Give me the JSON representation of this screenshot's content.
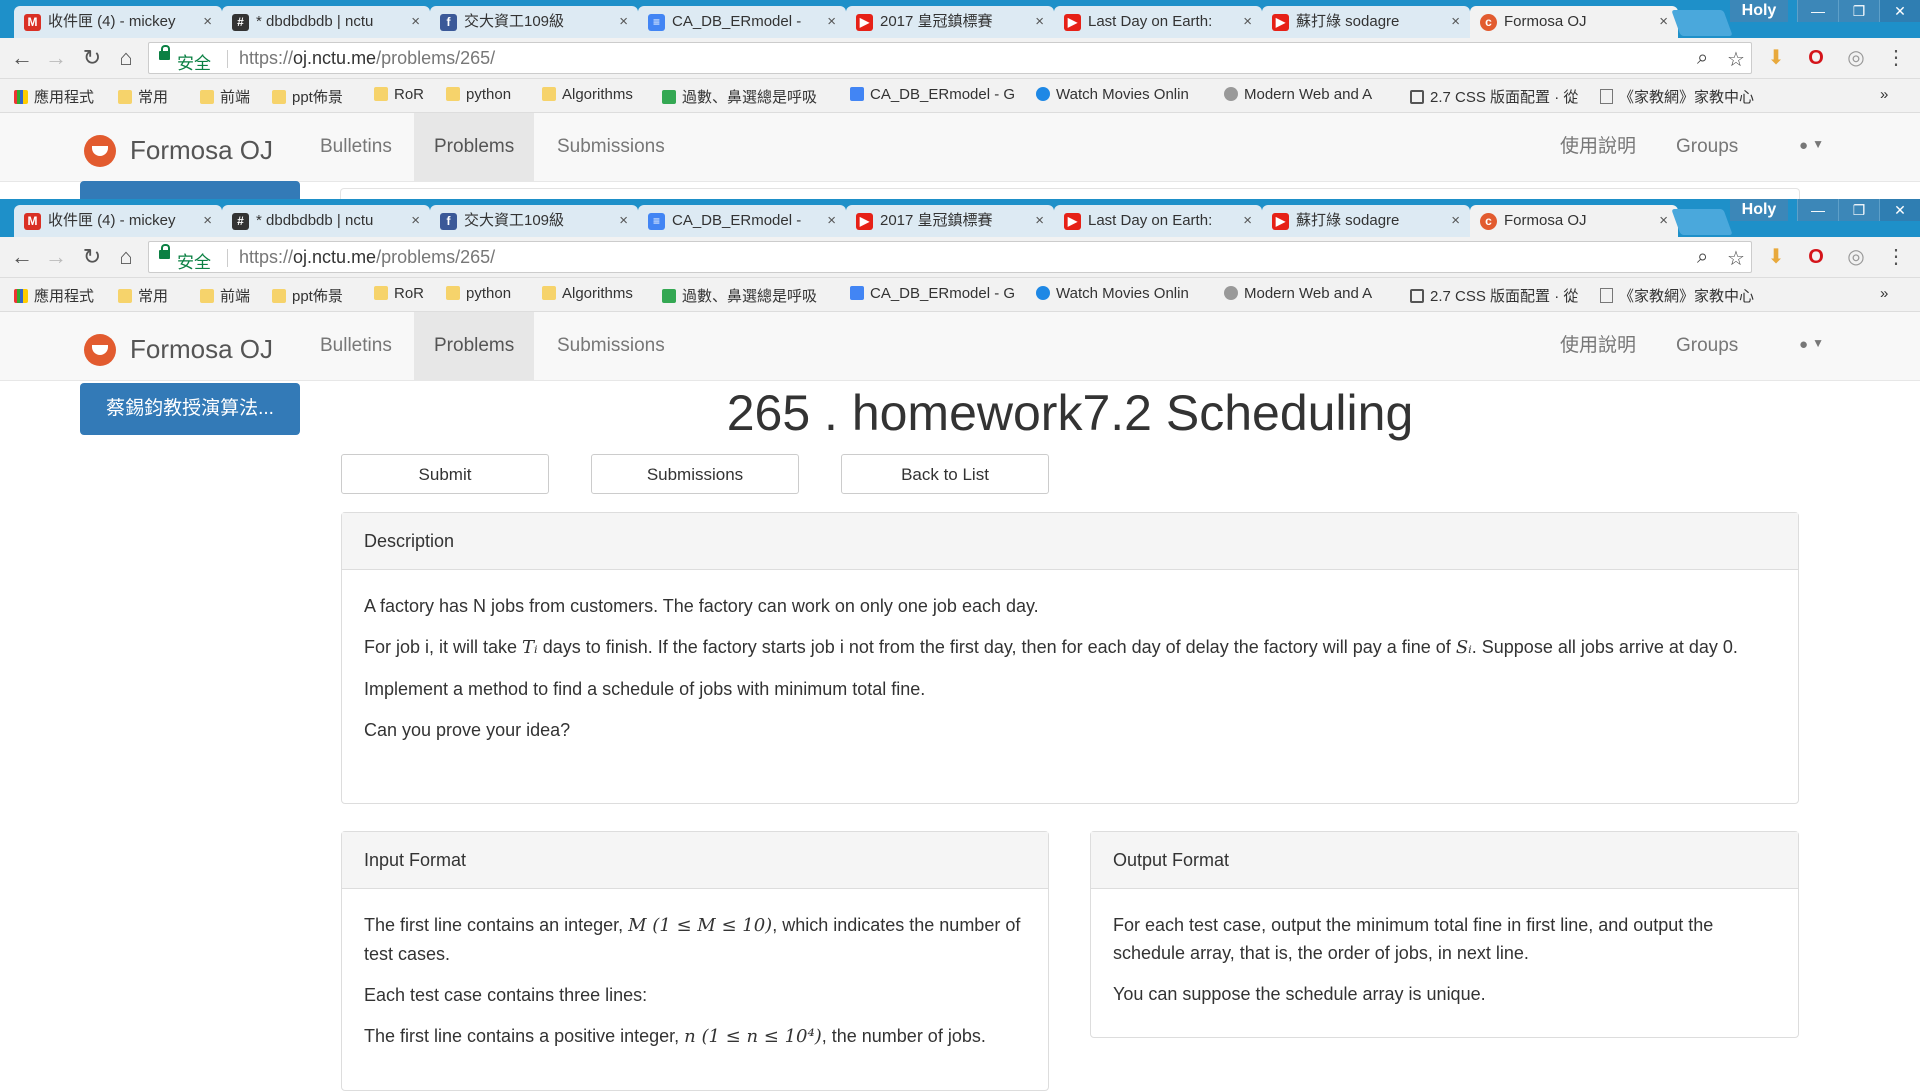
{
  "browser": {
    "tabs": [
      {
        "icon": "gmail-icon",
        "label": "收件匣 (4) - mickey"
      },
      {
        "icon": "slack-icon",
        "label": "* dbdbdbdb | nctu"
      },
      {
        "icon": "facebook-icon",
        "label": "交大資工109級"
      },
      {
        "icon": "docs-icon",
        "label": "CA_DB_ERmodel -"
      },
      {
        "icon": "youtube-icon",
        "label": "2017 皇冠鎮標賽"
      },
      {
        "icon": "youtube-icon",
        "label": "Last Day on Earth:"
      },
      {
        "icon": "youtube-icon",
        "label": "蘇打綠 sodagre"
      },
      {
        "icon": "formosa-icon",
        "label": "Formosa OJ"
      }
    ],
    "profile": "Holy",
    "secure_label": "安全",
    "url_prefix": "https://",
    "url_host": "oj.nctu.me",
    "url_path": "/problems/265/",
    "bookmarks": [
      {
        "icon": "apps-icon",
        "label": "應用程式"
      },
      {
        "icon": "folder-icon",
        "label": "常用"
      },
      {
        "icon": "folder-icon",
        "label": "前端"
      },
      {
        "icon": "folder-icon",
        "label": "ppt佈景"
      },
      {
        "icon": "folder-icon",
        "label": "RoR"
      },
      {
        "icon": "folder-icon",
        "label": "python"
      },
      {
        "icon": "folder-icon",
        "label": "Algorithms"
      },
      {
        "icon": "slides-icon",
        "label": "過數、鼻選總是呼吸"
      },
      {
        "icon": "docs-icon",
        "label": "CA_DB_ERmodel - G"
      },
      {
        "icon": "movie-icon",
        "label": "Watch Movies Onlin"
      },
      {
        "icon": "globe-icon",
        "label": "Modern Web and A"
      },
      {
        "icon": "book-icon",
        "label": "2.7 CSS 版面配置 · 從"
      },
      {
        "icon": "page-icon",
        "label": "《家教網》家教中心"
      }
    ],
    "more_bookmarks": "»"
  },
  "site": {
    "brand": "Formosa OJ",
    "nav": [
      "Bulletins",
      "Problems",
      "Submissions"
    ],
    "nav_right": [
      "使用說明",
      "Groups"
    ],
    "course_button": "蔡錫鈞教授演算法..."
  },
  "problem": {
    "title": "265 . homework7.2 Scheduling",
    "buttons": [
      "Submit",
      "Submissions",
      "Back to List"
    ],
    "description": {
      "heading": "Description",
      "p1": "A factory has N jobs from customers. The factory can work on only one job each day.",
      "p2_a": "For job i, it will take ",
      "p2_math1": "Tᵢ",
      "p2_b": " days to finish. If the factory starts job i not from the first day, then for each day of delay the factory will pay a fine of ",
      "p2_math2": "Sᵢ",
      "p2_c": ". Suppose all jobs arrive at day 0.",
      "p3": "Implement a method to find a schedule of jobs with minimum total fine.",
      "p4": "Can you prove your idea?"
    },
    "input_format": {
      "heading": "Input Format",
      "p1_a": "The first line contains an integer, ",
      "p1_math": "M (1 ≤ M ≤ 10)",
      "p1_b": ", which indicates the number of test cases.",
      "p2": "Each test case contains three lines:",
      "p3_a": "The first line contains a positive integer, ",
      "p3_math": "n (1 ≤ n ≤ 10⁴)",
      "p3_b": ", the number of jobs."
    },
    "output_format": {
      "heading": "Output Format",
      "p1": "For each test case, output the minimum total fine in first line, and output the schedule array, that is, the order of jobs, in next line.",
      "p2": "You can suppose the schedule array is unique."
    }
  }
}
